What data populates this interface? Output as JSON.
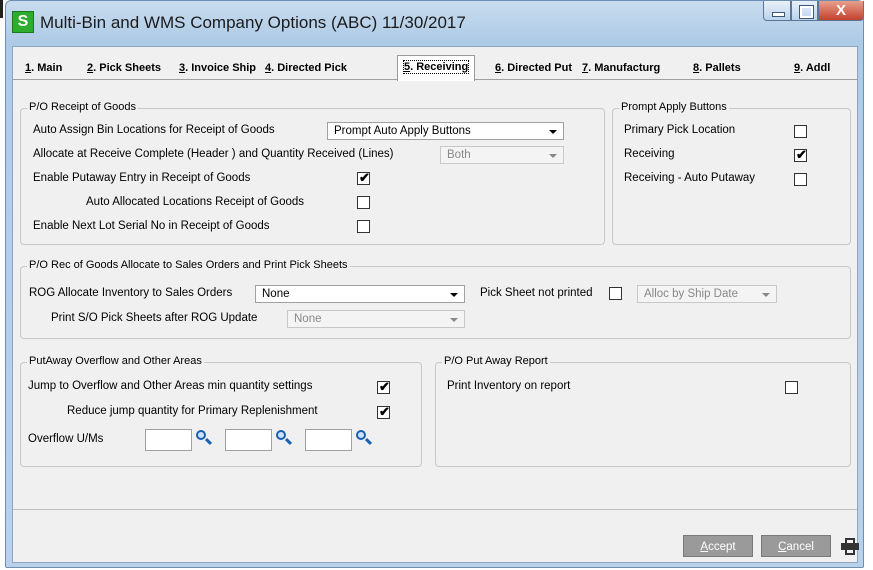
{
  "window": {
    "title": "Multi-Bin and WMS Company Options (ABC) 11/30/2017",
    "logo_letter": "S",
    "close_glyph": "X"
  },
  "tabs": [
    {
      "key": "1",
      "label": ". Main"
    },
    {
      "key": "2",
      "label": ". Pick Sheets"
    },
    {
      "key": "3",
      "label": ". Invoice Ship"
    },
    {
      "key": "4",
      "label": ". Directed Pick"
    },
    {
      "key": "5",
      "label": ". Receiving"
    },
    {
      "key": "6",
      "label": ". Directed Put"
    },
    {
      "key": "7",
      "label": ". Manufacturg"
    },
    {
      "key": "8",
      "label": ". Pallets"
    },
    {
      "key": "9",
      "label": ". Addl"
    }
  ],
  "po_receipt": {
    "title": "P/O Receipt of Goods",
    "auto_assign_label": "Auto Assign Bin Locations for Receipt of Goods",
    "auto_assign_value": "Prompt Auto Apply Buttons",
    "allocate_label": "Allocate at Receive Complete (Header ) and Quantity Received (Lines)",
    "allocate_value": "Both",
    "enable_putaway_label": "Enable Putaway Entry in Receipt of Goods",
    "enable_putaway_checked": "✔",
    "auto_allocated_label": "Auto Allocated Locations Receipt of Goods",
    "auto_allocated_checked": "",
    "next_lot_label": "Enable Next Lot Serial No in Receipt of Goods",
    "next_lot_checked": ""
  },
  "prompt_apply": {
    "title": "Prompt Apply Buttons",
    "primary_pick_label": "Primary Pick Location",
    "primary_pick_checked": "",
    "receiving_label": "Receiving",
    "receiving_checked": "✔",
    "auto_putaway_label": "Receiving - Auto Putaway",
    "auto_putaway_checked": ""
  },
  "rog_allocate": {
    "title": "P/O Rec of Goods Allocate to Sales Orders and Print Pick Sheets",
    "rog_label": "ROG Allocate Inventory to Sales Orders",
    "rog_value": "None",
    "print_label": "Print S/O Pick Sheets after ROG Update",
    "print_value": "None",
    "not_printed_label": "Pick Sheet not printed",
    "not_printed_checked": "",
    "alloc_value": "Alloc by Ship Date"
  },
  "putaway_overflow": {
    "title": "PutAway Overflow and Other Areas",
    "jump_label": "Jump to Overflow and Other Areas min quantity settings",
    "jump_checked": "✔",
    "reduce_label": "Reduce jump quantity for Primary Replenishment",
    "reduce_checked": "✔",
    "overflow_label": "Overflow U/Ms",
    "overflow_values": [
      "",
      "",
      ""
    ]
  },
  "po_putaway_report": {
    "title": "P/O Put Away Report",
    "print_inventory_label": "Print Inventory on report",
    "print_inventory_checked": ""
  },
  "footer": {
    "accept_key": "A",
    "accept_rest": "ccept",
    "cancel_key": "C",
    "cancel_rest": "ancel"
  },
  "icons": [
    "minimize-icon",
    "maximize-icon",
    "close-icon",
    "search-icon",
    "printer-icon",
    "check-icon"
  ],
  "colors": {
    "logo_green": "#2eac2e",
    "close_red": "#c5412c",
    "button_gray": "#9a9a9a",
    "lookup_blue": "#1c5fb0"
  }
}
